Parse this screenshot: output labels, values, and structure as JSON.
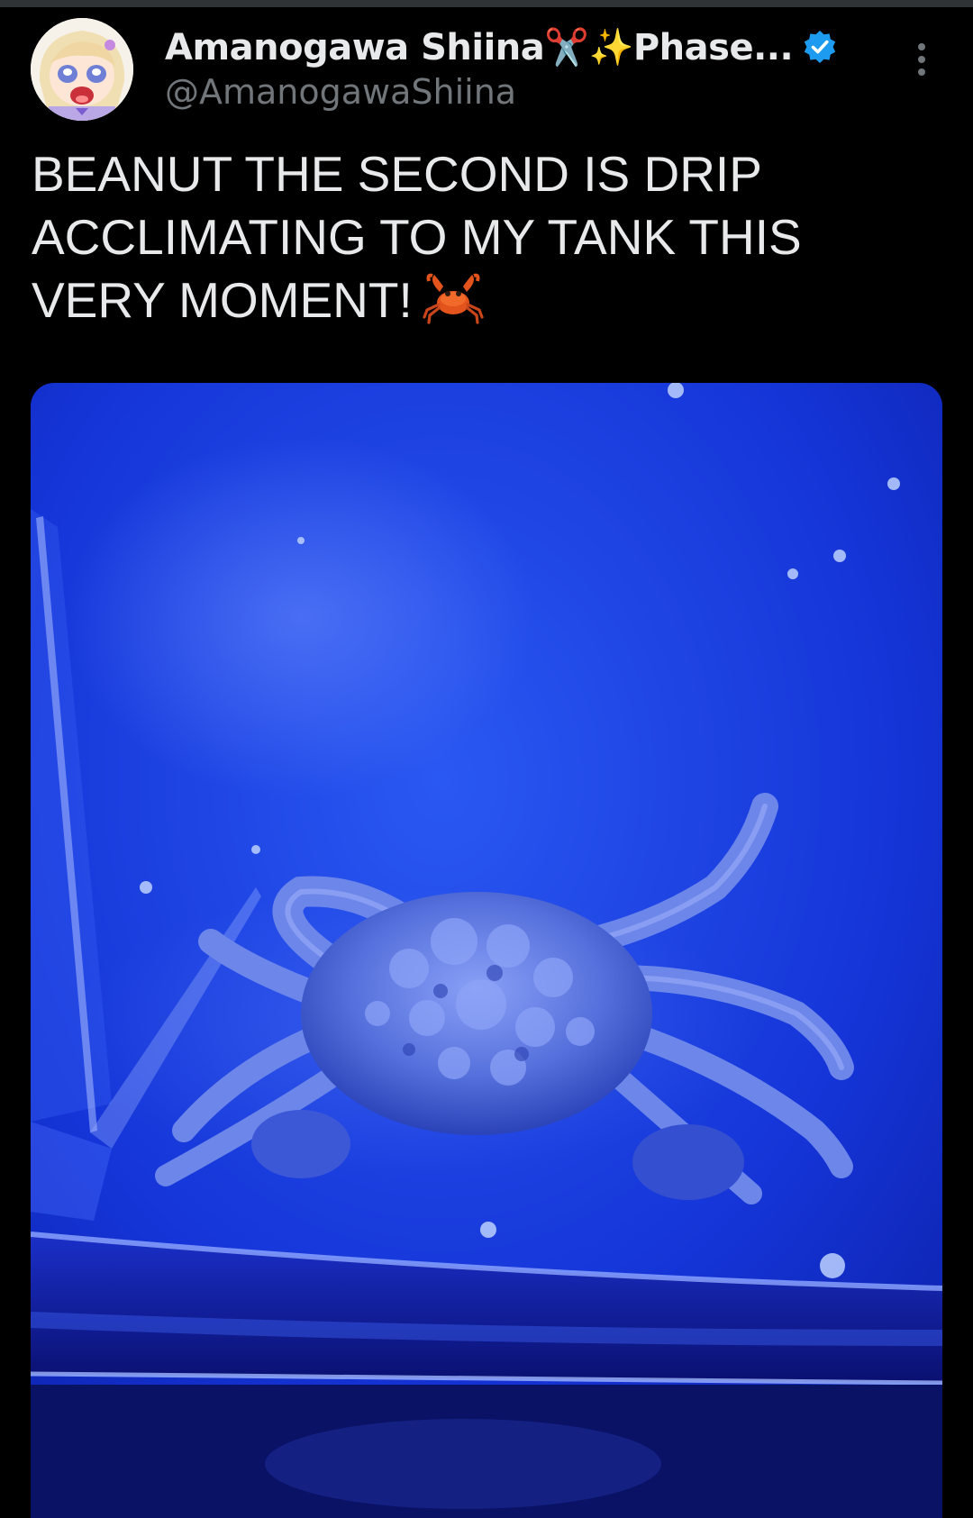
{
  "tweet": {
    "author": {
      "display_name": "Amanogawa Shiina✂️✨Phase...",
      "handle": "@AmanogawaShiina",
      "verified": true,
      "avatar": "anime-girl-avatar"
    },
    "text": "BEANUT THE SECOND IS DRIP ACCLIMATING TO MY TANK THIS VERY MOMENT!",
    "emoji": "crab-icon",
    "media": {
      "kind": "photo",
      "subject": "crab-in-aquarium-photo"
    }
  },
  "icons": {
    "more": "more-vertical-icon",
    "verified": "verified-badge-icon"
  },
  "colors": {
    "background": "#000000",
    "text_primary": "#e7e9ea",
    "text_secondary": "#71767b",
    "verified_blue": "#1d9bf0",
    "media_blue": "#1a33e0"
  }
}
